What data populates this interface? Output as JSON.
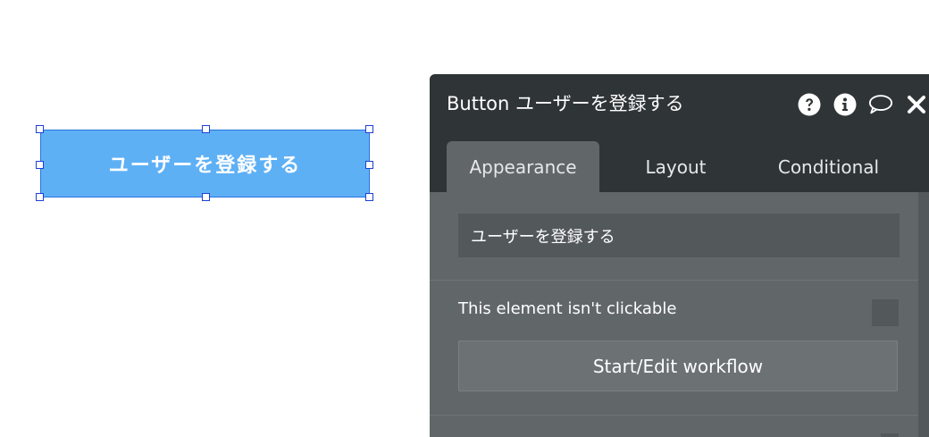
{
  "canvas": {
    "button_label": "ユーザーを登録する"
  },
  "panel": {
    "title": "Button ユーザーを登録する",
    "icons": [
      "help-icon",
      "info-icon",
      "comment-icon",
      "close-icon"
    ],
    "tabs": [
      {
        "label": "Appearance",
        "active": true
      },
      {
        "label": "Layout",
        "active": false
      },
      {
        "label": "Conditional",
        "active": false
      }
    ],
    "text_field_value": "ユーザーを登録する",
    "not_clickable_label": "This element isn't clickable",
    "not_clickable_checked": false,
    "workflow_button_label": "Start/Edit workflow"
  },
  "colors": {
    "button_fill": "#5eb0f5",
    "selection_border": "#1f3fd6",
    "panel_header": "#2f3436",
    "panel_body": "#616669"
  }
}
